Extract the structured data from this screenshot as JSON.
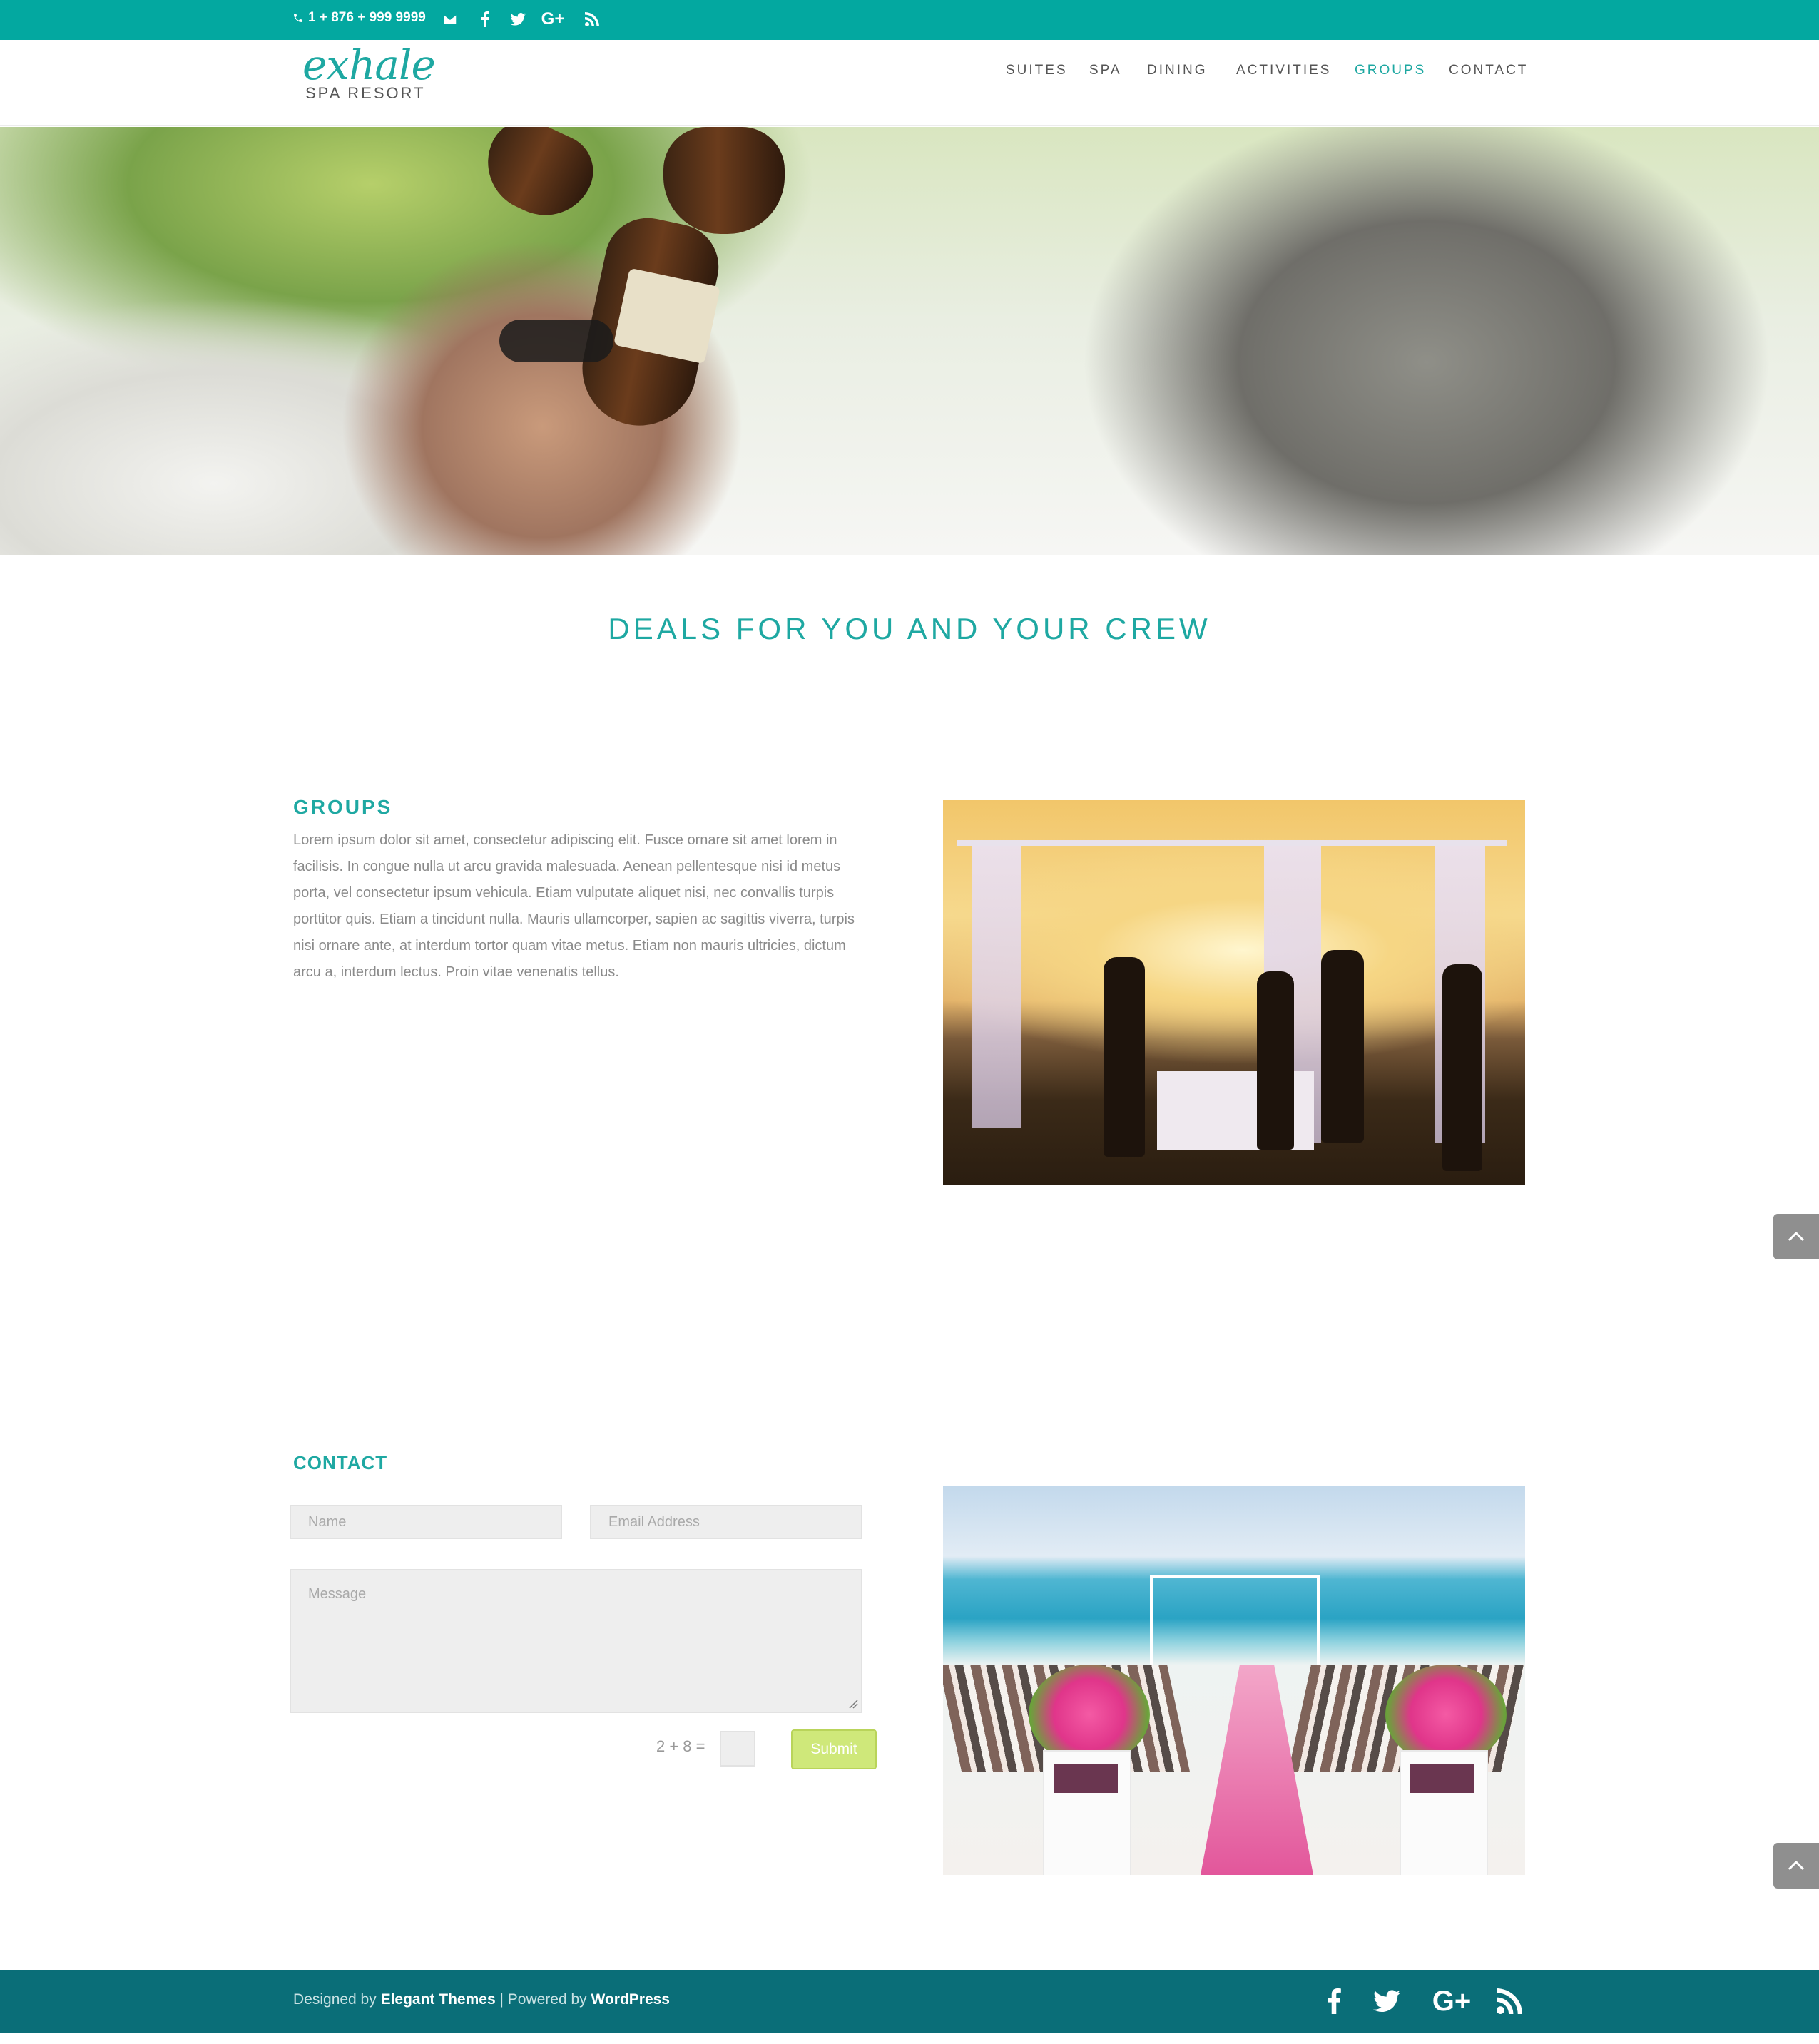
{
  "topbar": {
    "phone": "1 + 876 + 999 9999",
    "icons": [
      "phone-icon",
      "mail-icon",
      "facebook-icon",
      "twitter-icon",
      "google-plus-icon",
      "rss-icon"
    ]
  },
  "logo": {
    "word": "exhale",
    "sub": "SPA RESORT"
  },
  "nav": {
    "items": [
      {
        "label": "SUITES"
      },
      {
        "label": "SPA"
      },
      {
        "label": "DINING"
      },
      {
        "label": "ACTIVITIES"
      },
      {
        "label": "GROUPS",
        "active": true
      },
      {
        "label": "CONTACT"
      }
    ]
  },
  "hero": {
    "image": "group-toasting-photo"
  },
  "deals": {
    "title": "DEALS FOR YOU AND YOUR CREW"
  },
  "groups": {
    "title": "GROUPS",
    "body": "Lorem ipsum dolor sit amet, consectetur adipiscing elit. Fusce ornare sit amet lorem in facilisis. In congue nulla ut arcu gravida malesuada. Aenean pellentesque nisi id metus porta, vel consectetur ipsum vehicula. Etiam vulputate aliquet nisi, nec convallis turpis porttitor quis. Etiam a tincidunt nulla. Mauris ullamcorper, sapien ac sagittis viverra, turpis nisi ornare ante, at interdum tortor quam vitae metus. Etiam non mauris ultricies, dictum arcu a, interdum lectus. Proin vitae venenatis tellus.",
    "image": "beach-sunset-gathering-photo"
  },
  "contact": {
    "title": "CONTACT",
    "name_placeholder": "Name",
    "email_placeholder": "Email Address",
    "message_placeholder": "Message",
    "captcha": "2 + 8 =",
    "submit_label": "Submit",
    "image": "beach-wedding-photo"
  },
  "footer": {
    "designed_by": "Designed by ",
    "elegant": "Elegant Themes",
    "separator": " | Powered by ",
    "wordpress": "WordPress",
    "icons": [
      "facebook-icon",
      "twitter-icon",
      "google-plus-icon",
      "rss-icon"
    ]
  },
  "colors": {
    "accent": "#03a8a0",
    "footer": "#0a6e78",
    "submit": "#cfe87a"
  }
}
